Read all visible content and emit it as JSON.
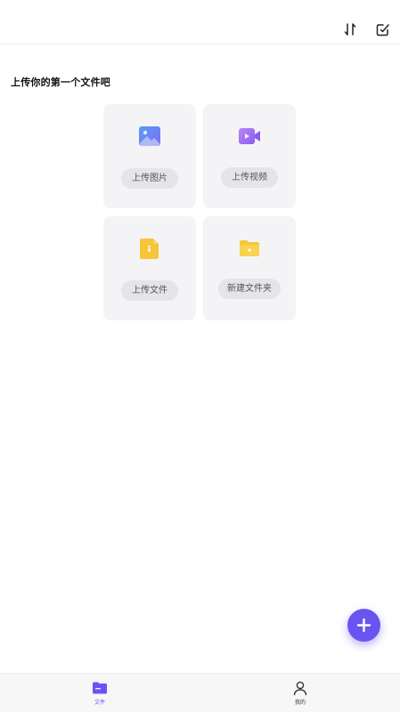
{
  "header": {
    "sort_icon": "sort-arrows-icon",
    "edit_icon": "edit-check-icon"
  },
  "main": {
    "title": "上传你的第一个文件吧",
    "cards": [
      {
        "label": "上传图片",
        "icon": "image-icon"
      },
      {
        "label": "上传视频",
        "icon": "video-icon"
      },
      {
        "label": "上传文件",
        "icon": "document-icon"
      },
      {
        "label": "新建文件夹",
        "icon": "folder-icon"
      }
    ]
  },
  "fab": {
    "icon": "plus-icon"
  },
  "bottom_nav": {
    "items": [
      {
        "label": "文件",
        "icon": "folder-icon",
        "active": true
      },
      {
        "label": "我的",
        "icon": "person-icon",
        "active": false
      }
    ]
  },
  "colors": {
    "accent": "#6a54f0",
    "image_blue": "#6a8cf2",
    "video_purple": "#9a6bf0",
    "doc_yellow": "#f7c432",
    "card_bg": "#f4f4f6"
  }
}
